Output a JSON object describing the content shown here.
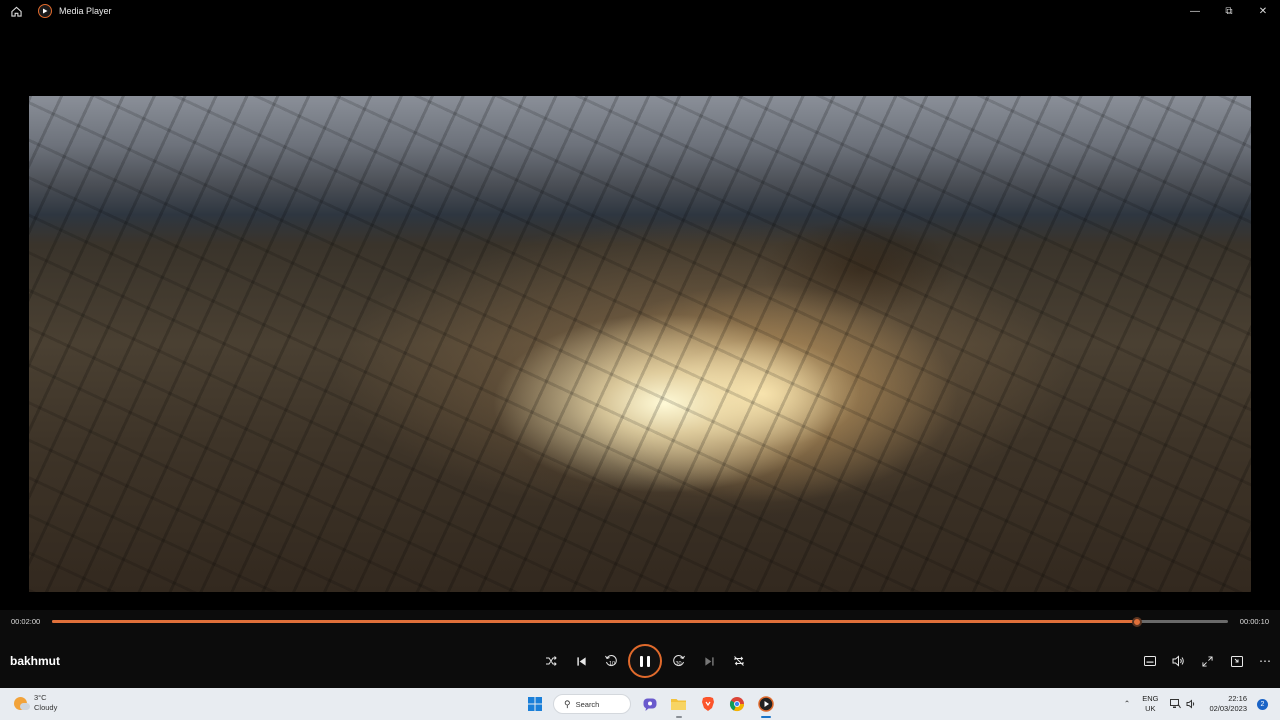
{
  "window": {
    "title": "Media Player"
  },
  "player": {
    "media_title": "bakhmut",
    "elapsed": "00:02:00",
    "remaining": "00:00:10",
    "progress": 0.923,
    "skip_back_seconds": "10",
    "skip_forward_seconds": "30",
    "accent_color": "#e06a2c"
  },
  "taskbar": {
    "weather": {
      "temperature": "3°C",
      "condition": "Cloudy"
    },
    "search_label": "Search",
    "language": {
      "primary": "ENG",
      "secondary": "UK"
    },
    "clock": {
      "time": "22:16",
      "date": "02/03/2023"
    },
    "notifications": "2"
  }
}
